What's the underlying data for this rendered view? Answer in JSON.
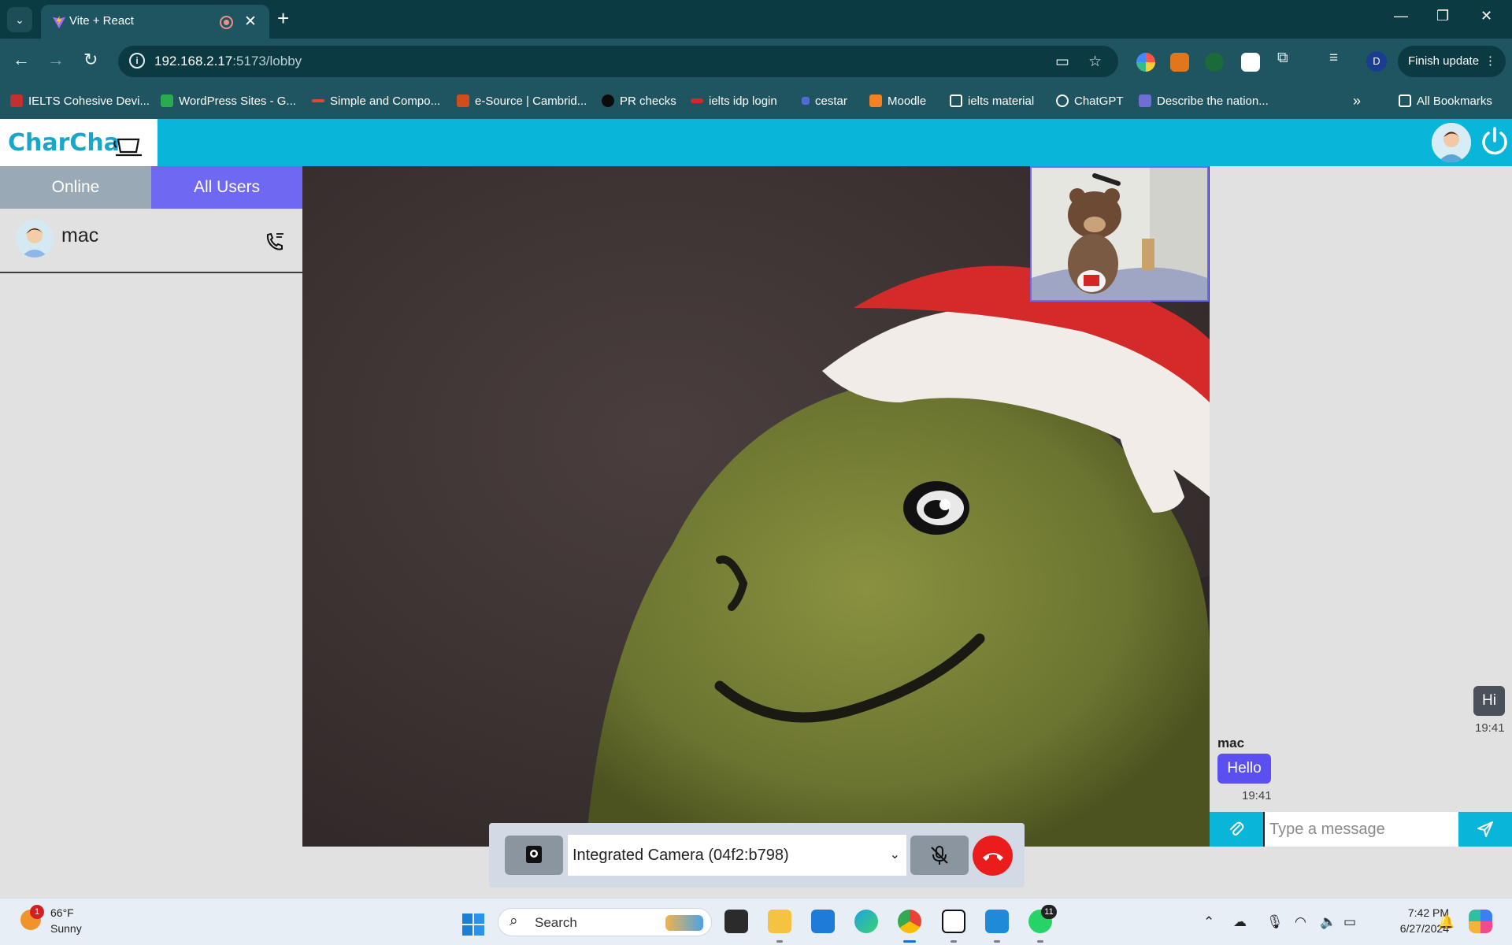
{
  "browser": {
    "tab_title": "Vite + React",
    "url_host": "192.168.2.17",
    "url_path": ":5173/lobby",
    "profile_initial": "D",
    "finish_update_label": "Finish update",
    "bookmarks": [
      {
        "label": "IELTS Cohesive Devi...",
        "color": "#c3312f"
      },
      {
        "label": "WordPress Sites - G...",
        "color": "#2da94f"
      },
      {
        "label": "Simple and Compo...",
        "color": "#e0482f"
      },
      {
        "label": "e-Source | Cambrid...",
        "color": "#d14d1e"
      },
      {
        "label": "PR checks",
        "color": "#0b0b0b"
      },
      {
        "label": "ielts idp login",
        "color": "#d8262b"
      },
      {
        "label": "cestar",
        "color": "#4f6cd6"
      },
      {
        "label": "Moodle",
        "color": "#f58220"
      },
      {
        "label": "ielts material",
        "color": "folder"
      },
      {
        "label": "ChatGPT",
        "color": "#ffffff"
      },
      {
        "label": "Describe the nation...",
        "color": "#6f6fd3"
      }
    ],
    "all_bookmarks_label": "All Bookmarks"
  },
  "app": {
    "logo_text": "CharCha",
    "tabs": {
      "online": "Online",
      "all_users": "All Users"
    },
    "users": [
      {
        "name": "mac"
      }
    ],
    "camera_select_value": "Integrated Camera (04f2:b798)",
    "chat": {
      "messages": [
        {
          "direction": "outgoing",
          "text": "Hi",
          "time": "19:41"
        },
        {
          "direction": "incoming",
          "sender": "mac",
          "text": "Hello",
          "time": "19:41"
        }
      ],
      "input_placeholder": "Type a message"
    },
    "colors": {
      "header": "#09b5d8",
      "accent": "#6e68f3",
      "end_call": "#ea1c1c"
    }
  },
  "taskbar": {
    "weather_badge": "1",
    "temperature": "66°F",
    "condition": "Sunny",
    "search_label": "Search",
    "whatsapp_badge": "11",
    "time": "7:42 PM",
    "date": "6/27/2024"
  }
}
